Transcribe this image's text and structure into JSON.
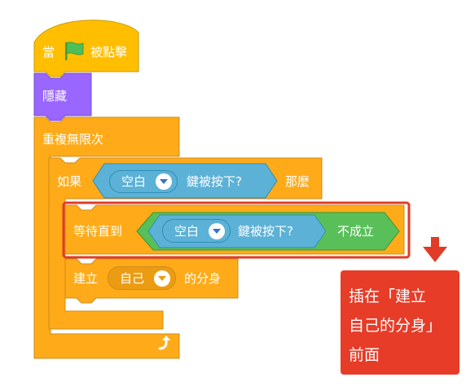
{
  "event_block": {
    "prefix": "當",
    "suffix": "被點擊",
    "flag_icon": "green-flag-icon"
  },
  "hide_block": {
    "label": "隱藏"
  },
  "forever_block": {
    "label": "重複無限次",
    "loop_icon": "loop-arrow-icon"
  },
  "if_block": {
    "if_label": "如果",
    "key_menu_value": "空白",
    "key_pressed_label": "鍵被按下?",
    "then_label": "那麼"
  },
  "wait_until_block": {
    "label": "等待直到",
    "key_menu_value": "空白",
    "key_pressed_label": "鍵被按下?",
    "not_label": "不成立"
  },
  "clone_block": {
    "label": "建立",
    "target_value": "自己",
    "suffix": "的分身"
  },
  "annotation": {
    "line1": "插在「建立",
    "line2": "自己的分身」",
    "line3": "前面",
    "arrow_icon": "down-arrow-icon"
  },
  "colors": {
    "events": "#ffbf00",
    "looks": "#9966ff",
    "control": "#ffab19",
    "sensing": "#5cb1d6",
    "operators": "#59c059",
    "highlight": "#e03c28",
    "callout": "#e63c28"
  }
}
